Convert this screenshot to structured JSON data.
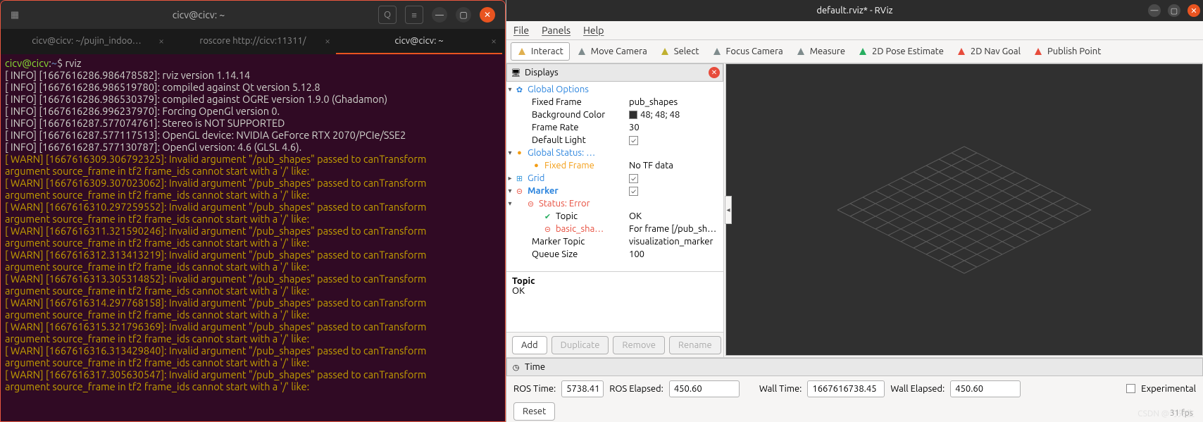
{
  "terminal": {
    "title": "cicv@cicv: ~",
    "tabs": [
      {
        "label": "cicv@cicv: ~/pujin_indoo…",
        "active": false
      },
      {
        "label": "roscore http://cicv:11311/",
        "active": false
      },
      {
        "label": "cicv@cicv: ~",
        "active": true
      }
    ],
    "prompt_user": "cicv@cicv",
    "prompt_path": "~",
    "command": "rviz",
    "lines": [
      {
        "lvl": "INFO",
        "ts": "1667616286.986478582",
        "msg": "rviz version 1.14.14"
      },
      {
        "lvl": "INFO",
        "ts": "1667616286.986519780",
        "msg": "compiled against Qt version 5.12.8"
      },
      {
        "lvl": "INFO",
        "ts": "1667616286.986530379",
        "msg": "compiled against OGRE version 1.9.0 (Ghadamon)"
      },
      {
        "lvl": "INFO",
        "ts": "1667616286.996237970",
        "msg": "Forcing OpenGl version 0."
      },
      {
        "lvl": "INFO",
        "ts": "1667616287.577074761",
        "msg": "Stereo is NOT SUPPORTED"
      },
      {
        "lvl": "INFO",
        "ts": "1667616287.577117513",
        "msg": "OpenGL device: NVIDIA GeForce RTX 2070/PCIe/SSE2"
      },
      {
        "lvl": "INFO",
        "ts": "1667616287.577130787",
        "msg": "OpenGl version: 4.6 (GLSL 4.6)."
      },
      {
        "lvl": "WARN",
        "ts": "1667616309.306792325",
        "msg": "Invalid argument \"/pub_shapes\" passed to canTransform",
        "extra": "argument source_frame in tf2 frame_ids cannot start with a '/' like:"
      },
      {
        "lvl": "WARN",
        "ts": "1667616309.307023062",
        "msg": "Invalid argument \"/pub_shapes\" passed to canTransform",
        "extra": "argument source_frame in tf2 frame_ids cannot start with a '/' like:"
      },
      {
        "lvl": "WARN",
        "ts": "1667616310.297259552",
        "msg": "Invalid argument \"/pub_shapes\" passed to canTransform",
        "extra": "argument source_frame in tf2 frame_ids cannot start with a '/' like:"
      },
      {
        "lvl": "WARN",
        "ts": "1667616311.321590246",
        "msg": "Invalid argument \"/pub_shapes\" passed to canTransform",
        "extra": "argument source_frame in tf2 frame_ids cannot start with a '/' like:"
      },
      {
        "lvl": "WARN",
        "ts": "1667616312.313413219",
        "msg": "Invalid argument \"/pub_shapes\" passed to canTransform",
        "extra": "argument source_frame in tf2 frame_ids cannot start with a '/' like:"
      },
      {
        "lvl": "WARN",
        "ts": "1667616313.305314852",
        "msg": "Invalid argument \"/pub_shapes\" passed to canTransform",
        "extra": "argument source_frame in tf2 frame_ids cannot start with a '/' like:"
      },
      {
        "lvl": "WARN",
        "ts": "1667616314.297768158",
        "msg": "Invalid argument \"/pub_shapes\" passed to canTransform",
        "extra": "argument source_frame in tf2 frame_ids cannot start with a '/' like:"
      },
      {
        "lvl": "WARN",
        "ts": "1667616315.321796369",
        "msg": "Invalid argument \"/pub_shapes\" passed to canTransform",
        "extra": "argument source_frame in tf2 frame_ids cannot start with a '/' like:"
      },
      {
        "lvl": "WARN",
        "ts": "1667616316.313429840",
        "msg": "Invalid argument \"/pub_shapes\" passed to canTransform",
        "extra": "argument source_frame in tf2 frame_ids cannot start with a '/' like:"
      },
      {
        "lvl": "WARN",
        "ts": "1667616317.305630547",
        "msg": "Invalid argument \"/pub_shapes\" passed to canTransform",
        "extra": "argument source_frame in tf2 frame_ids cannot start with a '/' like:"
      }
    ]
  },
  "rviz": {
    "title": "default.rviz* - RViz",
    "menu": [
      "File",
      "Panels",
      "Help"
    ],
    "tools": [
      {
        "label": "Interact",
        "icon": "hand-icon",
        "color": "#e0b050",
        "selected": true
      },
      {
        "label": "Move Camera",
        "icon": "move-icon",
        "color": "#7f8c8d"
      },
      {
        "label": "Select",
        "icon": "select-icon",
        "color": "#c0b030"
      },
      {
        "label": "Focus Camera",
        "icon": "focus-icon",
        "color": "#7f8c8d"
      },
      {
        "label": "Measure",
        "icon": "measure-icon",
        "color": "#7f8c8d"
      },
      {
        "label": "2D Pose Estimate",
        "icon": "arrow-icon",
        "color": "#27ae60"
      },
      {
        "label": "2D Nav Goal",
        "icon": "arrow-icon",
        "color": "#e74c3c"
      },
      {
        "label": "Publish Point",
        "icon": "pin-icon",
        "color": "#e74c3c"
      }
    ],
    "displays_header": "Displays",
    "tree": {
      "global_options": "Global Options",
      "fixed_frame_lbl": "Fixed Frame",
      "fixed_frame_val": "pub_shapes",
      "bg_lbl": "Background Color",
      "bg_val": "48; 48; 48",
      "fr_lbl": "Frame Rate",
      "fr_val": "30",
      "dl_lbl": "Default Light",
      "dl_val": "✓",
      "gs_lbl": "Global Status: …",
      "gs_frame_lbl": "Fixed Frame",
      "gs_frame_val": "No TF data",
      "grid_lbl": "Grid",
      "grid_val": "✓",
      "marker_lbl": "Marker",
      "marker_val": "✓",
      "status_lbl": "Status: Error",
      "topic_lbl": "Topic",
      "topic_val": "OK",
      "bs_lbl": "basic_sha…",
      "bs_val": "For frame [/pub_sh…",
      "mt_lbl": "Marker Topic",
      "mt_val": "visualization_marker",
      "qs_lbl": "Queue Size",
      "qs_val": "100"
    },
    "desc": {
      "title": "Topic",
      "body": "OK"
    },
    "buttons": {
      "add": "Add",
      "dup": "Duplicate",
      "rem": "Remove",
      "ren": "Rename"
    },
    "time": {
      "header": "Time",
      "rostime_lbl": "ROS Time:",
      "rostime_val": "5738.41",
      "roselap_lbl": "ROS Elapsed:",
      "roselap_val": "450.60",
      "walltime_lbl": "Wall Time:",
      "walltime_val": "1667616738.45",
      "wallelap_lbl": "Wall Elapsed:",
      "wallelap_val": "450.60",
      "experimental": "Experimental",
      "reset": "Reset",
      "fps": "31 fps"
    }
  },
  "watermark": "CSDN @勺先生"
}
